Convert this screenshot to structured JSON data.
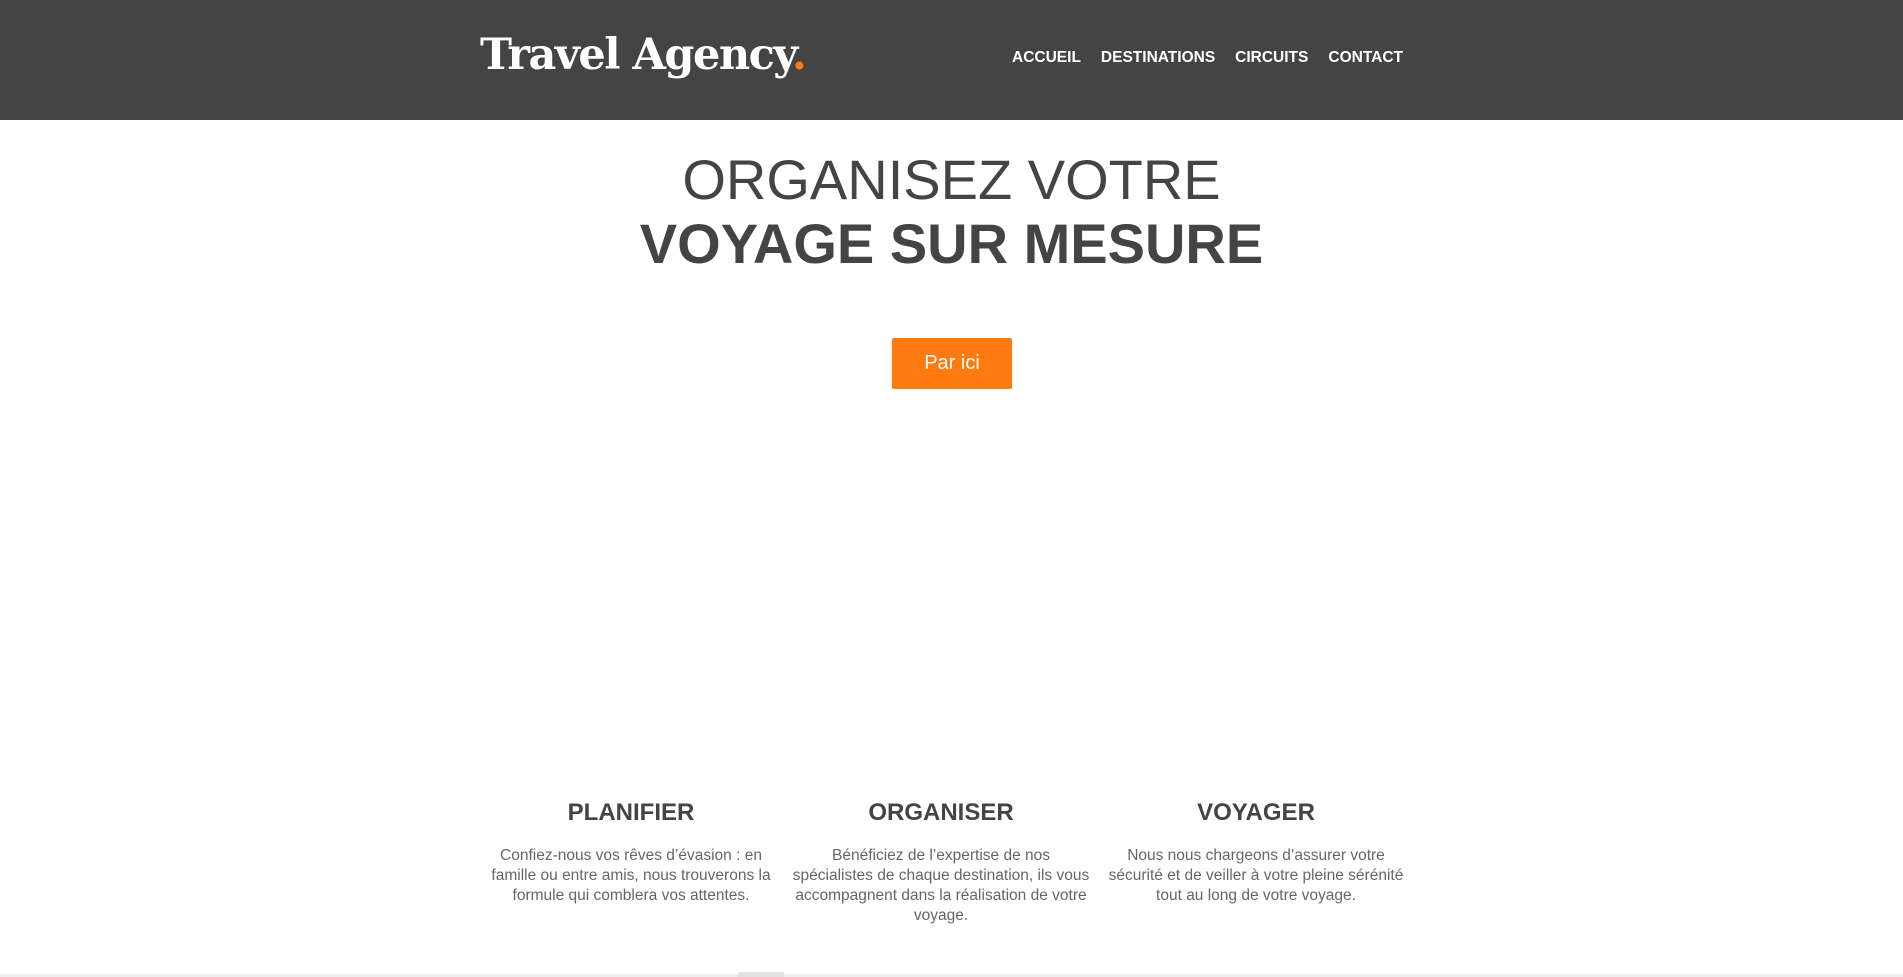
{
  "header": {
    "logo_text": "Travel Agency",
    "logo_dot": ".",
    "nav": [
      {
        "label": "ACCUEIL"
      },
      {
        "label": "DESTINATIONS"
      },
      {
        "label": "CIRCUITS"
      },
      {
        "label": "CONTACT"
      }
    ]
  },
  "hero": {
    "line1": "ORGANISEZ VOTRE",
    "line2": "VOYAGE SUR MESURE",
    "cta_label": "Par ici"
  },
  "features": [
    {
      "title": "PLANIFIER",
      "text": "Confiez-nous vos rêves d’évasion : en famille ou entre amis, nous trouverons la formule qui comblera vos attentes."
    },
    {
      "title": "ORGANISER",
      "text": "Bénéficiez de l’expertise de nos spécialistes de chaque destination, ils vous accompagnent dans la réalisation de votre voyage."
    },
    {
      "title": "VOYAGER",
      "text": "Nous nous chargeons d’assurer votre sécurité et de veiller à votre pleine sérénité tout au long de votre voyage."
    }
  ],
  "colors": {
    "header_bg": "#444444",
    "accent": "#ff7a0f",
    "text_dark": "#444444",
    "text_body": "#666666"
  }
}
